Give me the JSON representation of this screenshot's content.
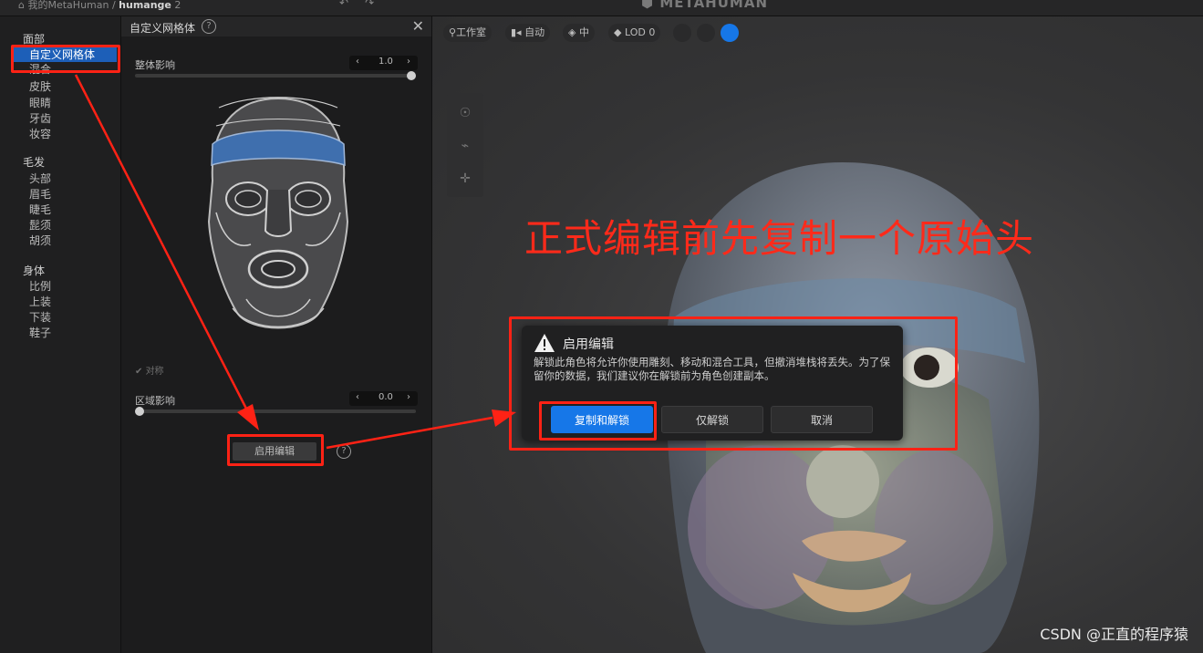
{
  "topbar": {
    "crumb_prefix": "我的MetaHuman /",
    "crumb_current": "humange",
    "crumb_suffix": "2",
    "brand": "METAHUMAN"
  },
  "nav": {
    "face_category": "面部",
    "face_items": [
      "自定义网格体",
      "混合",
      "皮肤",
      "眼睛",
      "牙齿",
      "妆容"
    ],
    "hair_category": "毛发",
    "hair_items": [
      "头部",
      "眉毛",
      "睫毛",
      "髭须",
      "胡须"
    ],
    "body_category": "身体",
    "body_items": [
      "比例",
      "上装",
      "下装",
      "鞋子"
    ]
  },
  "panel": {
    "title": "自定义网格体",
    "overall_label": "整体影响",
    "overall_value": "1.0",
    "overall_level": 1.0,
    "symmetry_label": "对称",
    "region_label": "区域影响",
    "region_value": "0.0",
    "region_level": 0.0,
    "enable_button": "启用编辑"
  },
  "viewport": {
    "pills": [
      "工作室",
      "自动",
      "中",
      "LOD 0"
    ],
    "annotation": "正式编辑前先复制一个原始头",
    "watermark": "CSDN @正直的程序猿"
  },
  "dialog": {
    "title": "启用编辑",
    "body": "解锁此角色将允许你使用雕刻、移动和混合工具，但撤消堆栈将丢失。为了保留你的数据，我们建议你在解锁前为角色创建副本。",
    "buttons": [
      "复制和解锁",
      "仅解锁",
      "取消"
    ]
  },
  "colors": {
    "accent": "#1677e8",
    "annotation_red": "#ff2215",
    "nav_active": "#1d5fb8"
  }
}
